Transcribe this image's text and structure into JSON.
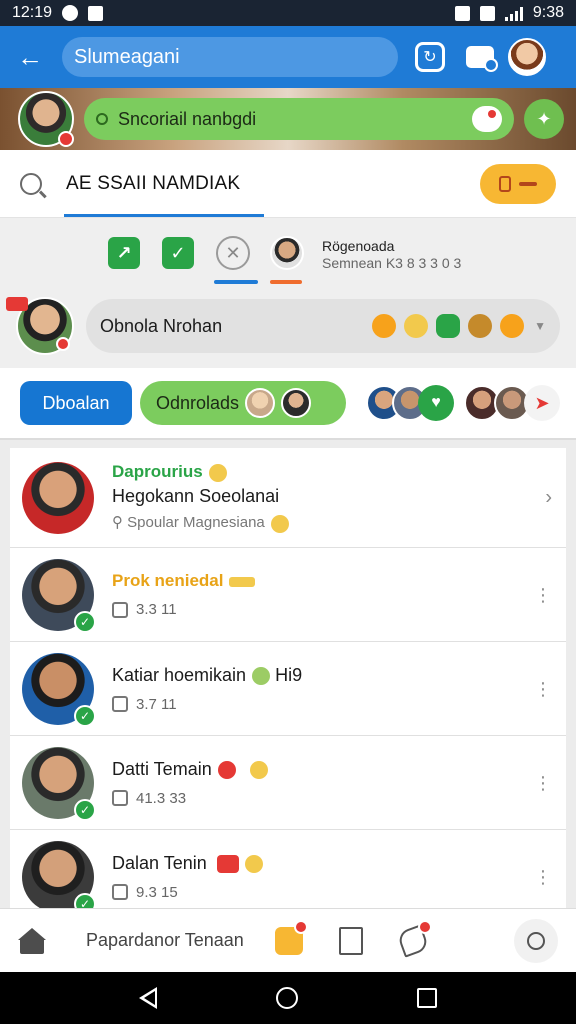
{
  "status_bar": {
    "time": "12:19",
    "right_time": "9:38"
  },
  "app_bar": {
    "title": "Slumeagani"
  },
  "banner": {
    "pill_text": "Sncoriail nanbgdi"
  },
  "search": {
    "text": "AE SSAII NAMDIAK"
  },
  "tabs": {
    "meta_name": "Rögenoada",
    "meta_sub": "Semnean K3 8 3 3 0 3"
  },
  "channel": {
    "label": "Obnola Nrohan"
  },
  "filters": {
    "primary": "Dboalan",
    "secondary": "Odnrolads"
  },
  "list": [
    {
      "l1": "Daprourius",
      "l2": "Hegokann Soeolanai",
      "l3": "Spoular Magnesiana",
      "likes": ""
    },
    {
      "l1": "Prok neniedal",
      "l2": "",
      "l3": "",
      "likes": "3.3 11"
    },
    {
      "l1": "Katiar hoemikain",
      "l1_suffix": "Hi9",
      "l2": "",
      "l3": "",
      "likes": "3.7 11"
    },
    {
      "l1": "Datti Temain",
      "l2": "",
      "l3": "",
      "likes": "41.3 33"
    },
    {
      "l1": "Dalan Tenin",
      "l2": "",
      "l3": "",
      "likes": "9.3 15"
    }
  ],
  "bottom_nav": {
    "label": "Papardanor Tenaan"
  },
  "colors": {
    "primary_blue": "#1f7bd6",
    "green": "#7ccc5e",
    "accent_orange": "#f7b733",
    "alert_red": "#e53935"
  },
  "icons": [
    "back-arrow-icon",
    "sync-icon",
    "chat-icon",
    "search-icon",
    "filter-icon",
    "close-icon",
    "home-icon",
    "key-icon",
    "book-icon",
    "pen-icon",
    "profile-icon"
  ]
}
